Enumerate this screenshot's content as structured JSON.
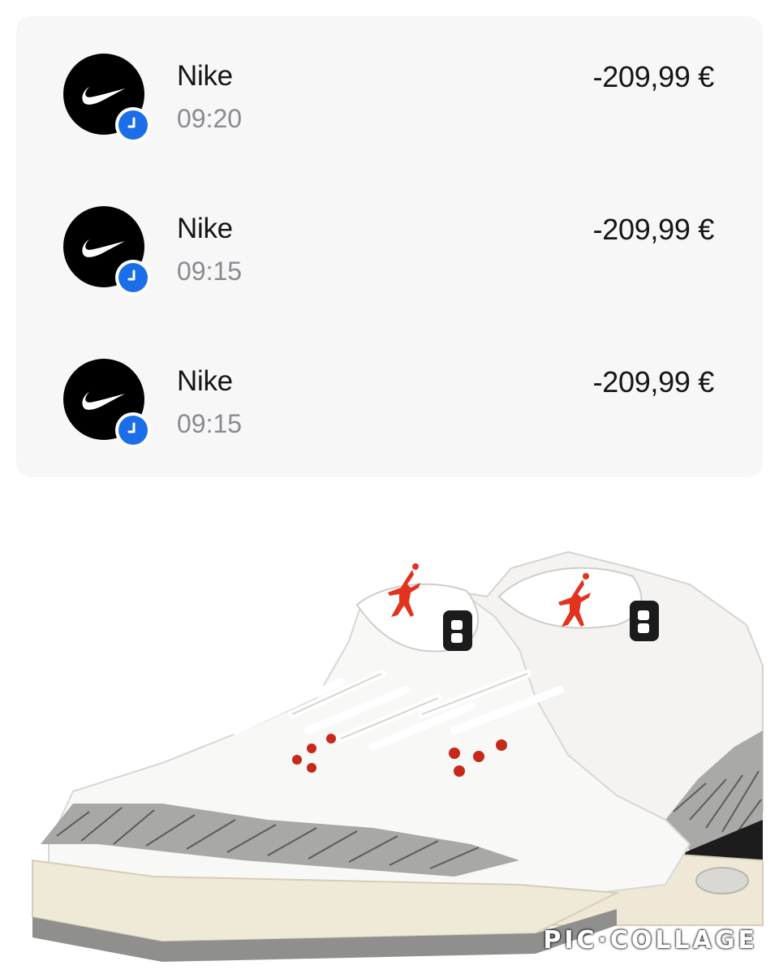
{
  "transactions": [
    {
      "merchant": "Nike",
      "time": "09:20",
      "amount": "-209,99 €",
      "logo_icon": "nike-swoosh-icon",
      "status_icon": "clock-icon"
    },
    {
      "merchant": "Nike",
      "time": "09:15",
      "amount": "-209,99 €",
      "logo_icon": "nike-swoosh-icon",
      "status_icon": "clock-icon"
    },
    {
      "merchant": "Nike",
      "time": "09:15",
      "amount": "-209,99 €",
      "logo_icon": "nike-swoosh-icon",
      "status_icon": "clock-icon"
    }
  ],
  "colors": {
    "card_background": "#f7f7f8",
    "pending_badge": "#1b6ee8",
    "primary_text": "#151515",
    "secondary_text": "#8a8a92",
    "jumpman_red": "#e2331f"
  },
  "image": {
    "subject": "sneaker-photo",
    "watermark": "PIC·COLLAGE"
  }
}
